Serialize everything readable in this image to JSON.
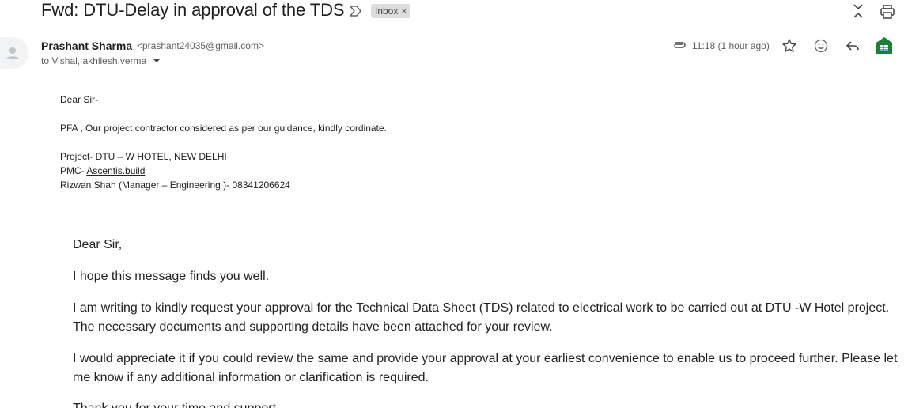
{
  "header": {
    "subject": "Fwd: DTU-Delay in approval of the TDS",
    "label_chip": "Inbox",
    "chip_close": "×",
    "important_icon": "important-marker-icon",
    "expand_icon": "expand-collapse-icon",
    "print_icon": "print-icon"
  },
  "message": {
    "sender_name": "Prashant Sharma",
    "sender_email": "<prashant24035@gmail.com>",
    "recipients": "to Vishal, akhilesh.verma",
    "timestamp": "11:18 (1 hour ago)",
    "icons": {
      "avatar": "person-avatar-icon",
      "attachment": "paperclip-icon",
      "star": "star-icon",
      "emoji": "emoji-icon",
      "reply": "reply-icon",
      "app": "sheets-app-icon",
      "caret": "chevron-down-icon"
    }
  },
  "body": {
    "greeting_short": "Dear Sir-",
    "pfa_line": "PFA , Our project contractor considered as per our guidance, kindly cordinate.",
    "project_line": "Project- DTU – W HOTEL, NEW DELHI",
    "pmc_prefix": "PMC- ",
    "pmc_link": "Ascentis.build",
    "contact_line": "Rizwan Shah (Manager – Engineering )- 08341206624",
    "forwarded": {
      "greeting": "Dear Sir,",
      "p1": "I hope this message finds you well.",
      "p2": "I am writing to kindly request your approval for the Technical Data Sheet (TDS) related to electrical work to be carried out at DTU -W Hotel project. The necessary documents and supporting details have been attached for your review.",
      "p3": "I would appreciate it if you could review the same and provide your approval at your earliest convenience to enable us to proceed further. Please let me know if any additional information or clarification is required.",
      "p4": "Thank you for your time and support."
    }
  },
  "colors": {
    "chip_bg": "#dddddd",
    "sheets_green": "#188038",
    "sheets_blue": "#1a73e8",
    "muted_text": "#5e5e5e"
  }
}
